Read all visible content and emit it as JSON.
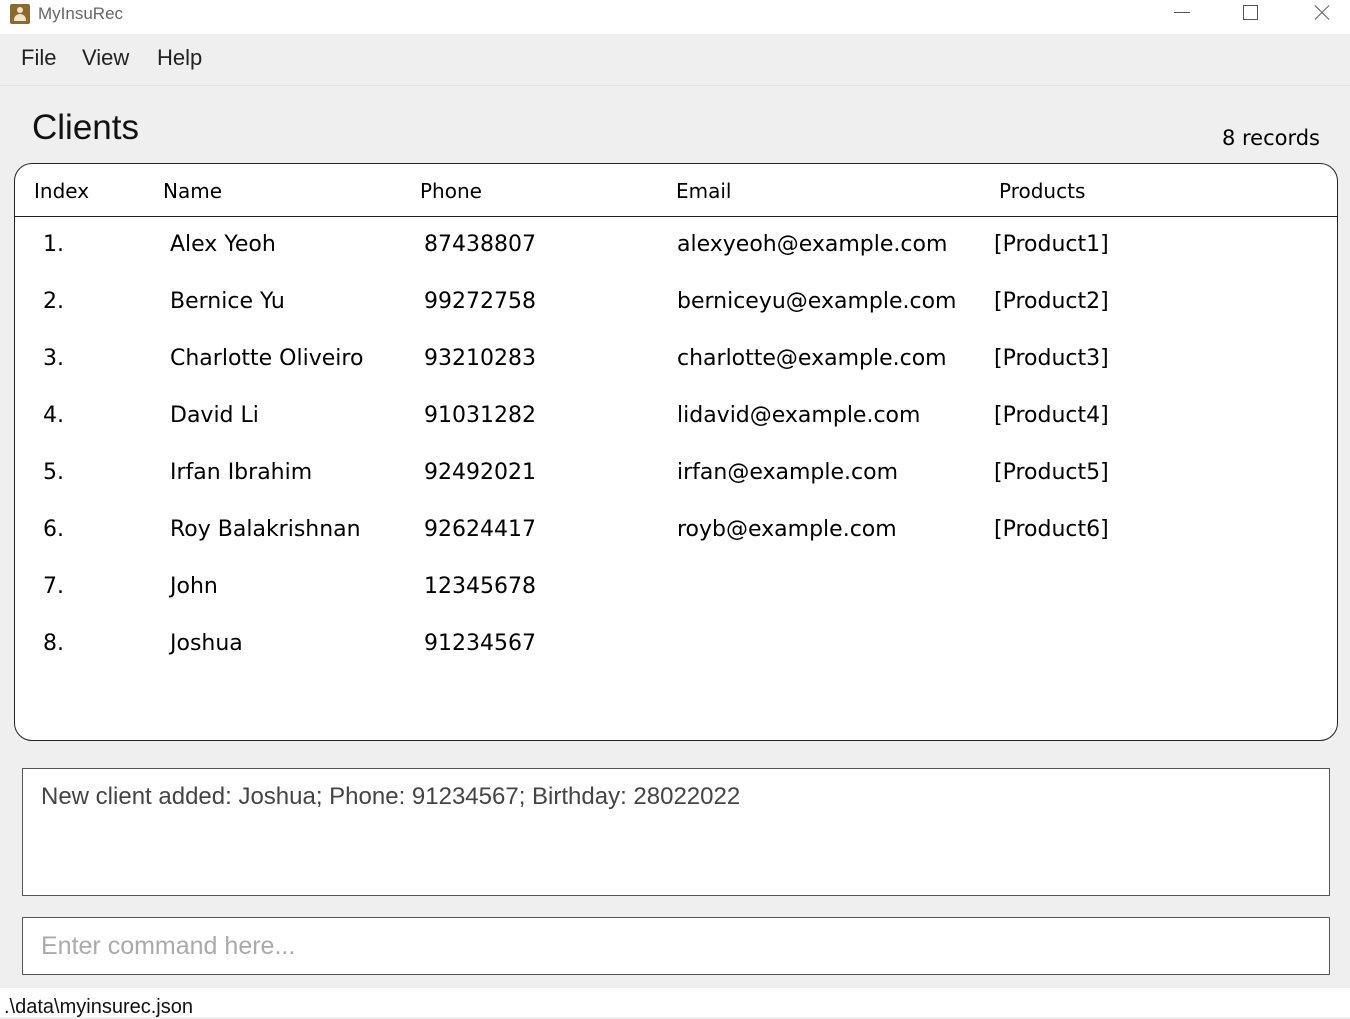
{
  "window": {
    "title": "MyInsuRec",
    "icon": "contact-book-icon"
  },
  "menu": {
    "items": [
      "File",
      "View",
      "Help"
    ]
  },
  "clients_panel": {
    "title": "Clients",
    "record_count": "8 records",
    "columns": [
      "Index",
      "Name",
      "Phone",
      "Email",
      "Products"
    ],
    "rows": [
      {
        "index": "1.",
        "name": "Alex Yeoh",
        "phone": "87438807",
        "email": "alexyeoh@example.com",
        "products": "[Product1]"
      },
      {
        "index": "2.",
        "name": "Bernice Yu",
        "phone": "99272758",
        "email": "berniceyu@example.com",
        "products": "[Product2]"
      },
      {
        "index": "3.",
        "name": "Charlotte Oliveiro",
        "phone": "93210283",
        "email": "charlotte@example.com",
        "products": "[Product3]"
      },
      {
        "index": "4.",
        "name": "David Li",
        "phone": "91031282",
        "email": "lidavid@example.com",
        "products": "[Product4]"
      },
      {
        "index": "5.",
        "name": "Irfan Ibrahim",
        "phone": "92492021",
        "email": "irfan@example.com",
        "products": "[Product5]"
      },
      {
        "index": "6.",
        "name": "Roy Balakrishnan",
        "phone": "92624417",
        "email": "royb@example.com",
        "products": "[Product6]"
      },
      {
        "index": "7.",
        "name": "John",
        "phone": "12345678",
        "email": "",
        "products": ""
      },
      {
        "index": "8.",
        "name": "Joshua",
        "phone": "91234567",
        "email": "",
        "products": ""
      }
    ]
  },
  "result_display": {
    "text": "New client added: Joshua; Phone: 91234567; Birthday: 28022022"
  },
  "command_box": {
    "placeholder": "Enter command here...",
    "value": ""
  },
  "status_bar": {
    "file_path": ".\\data\\myinsurec.json"
  }
}
